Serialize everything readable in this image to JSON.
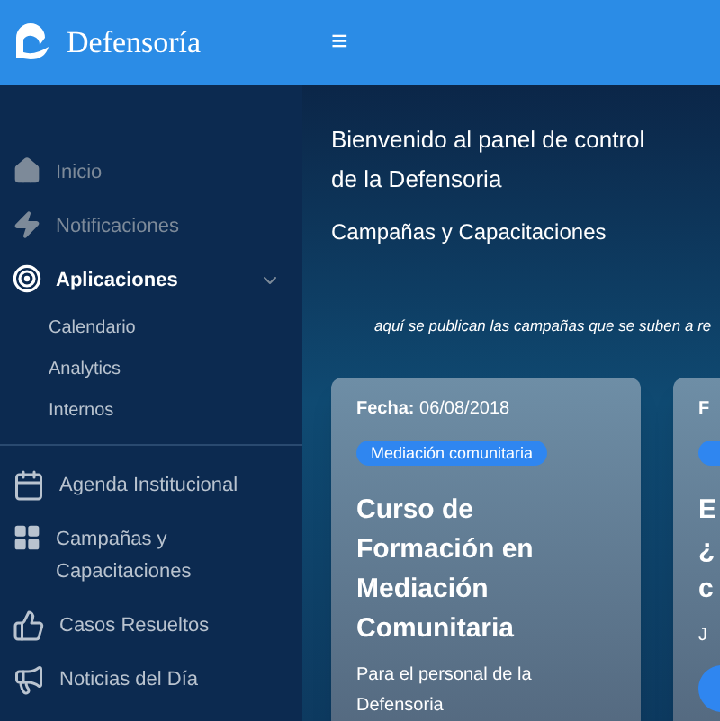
{
  "header": {
    "brand": "Defensoría",
    "menu_icon": "≡"
  },
  "sidebar": {
    "items": [
      {
        "label": "Inicio",
        "kind": "item",
        "dimmed": true,
        "selected": false
      },
      {
        "label": "Notificaciones",
        "kind": "item",
        "dimmed": true,
        "selected": false
      },
      {
        "label": "Aplicaciones",
        "kind": "item",
        "dimmed": false,
        "selected": true,
        "expanded": true,
        "children": [
          {
            "label": "Calendario"
          },
          {
            "label": "Analytics"
          },
          {
            "label": "Internos"
          }
        ]
      },
      {
        "kind": "divider"
      },
      {
        "label": "Agenda Institucional",
        "kind": "item",
        "dimmed": false,
        "selected": false
      },
      {
        "label": "Campañas y Capacitaciones",
        "kind": "item",
        "dimmed": false,
        "selected": false
      },
      {
        "label": "Casos Resueltos",
        "kind": "item",
        "dimmed": false,
        "selected": false
      },
      {
        "label": "Noticias del Día",
        "kind": "item",
        "dimmed": false,
        "selected": false
      }
    ]
  },
  "main": {
    "title": "Bienvenido al panel de control de la Defensoria",
    "subtitle": "Campañas y Capacitaciones",
    "note": "aquí se publican las campañas que se suben a re",
    "cards": [
      {
        "date_label": "Fecha:",
        "date": "06/08/2018",
        "tag": "Mediación comunitaria",
        "title_lines": [
          "Curso de",
          "Formación en",
          "Mediación",
          "Comunitaria"
        ],
        "description": "Para el personal de la Defensoria"
      },
      {
        "date_label": "F",
        "title_lines": [
          "E",
          "¿",
          "c"
        ],
        "description": "J",
        "has_button": true
      }
    ]
  }
}
